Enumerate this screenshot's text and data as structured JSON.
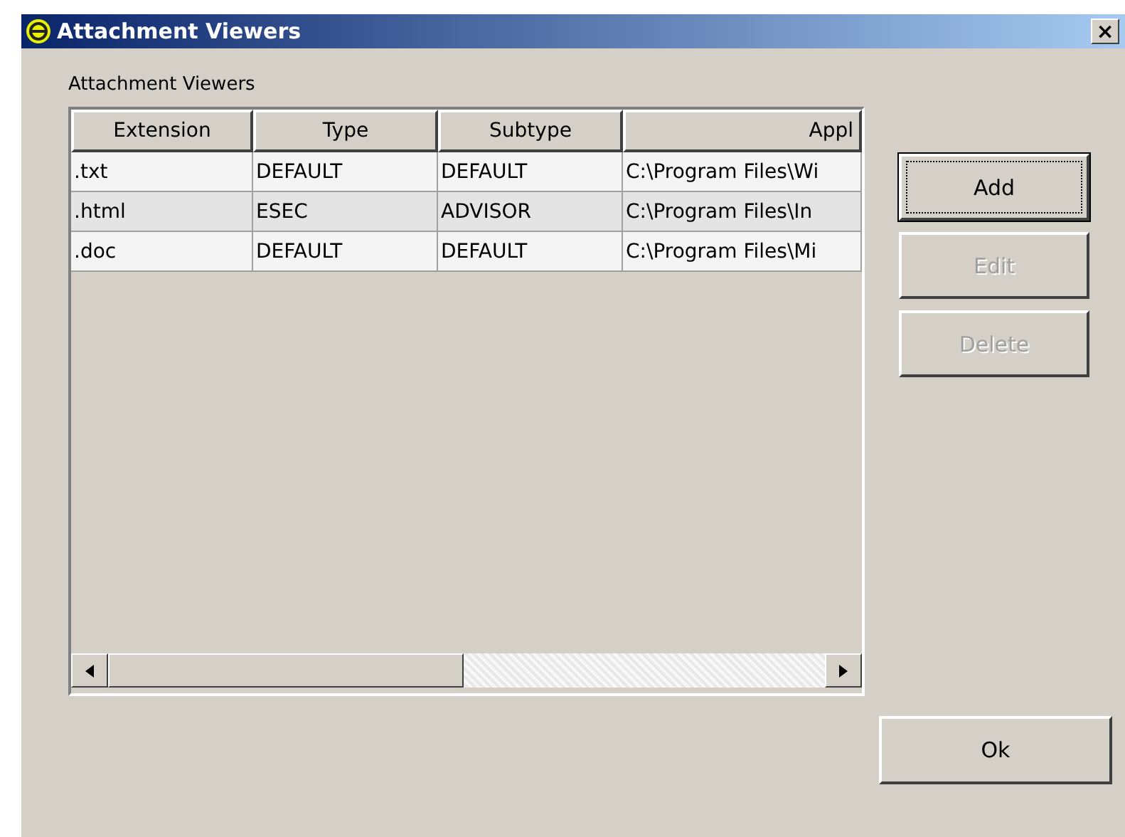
{
  "window": {
    "title": "Attachment Viewers",
    "close": "×"
  },
  "group_label": "Attachment Viewers",
  "table": {
    "columns": [
      "Extension",
      "Type",
      "Subtype",
      "Appl"
    ],
    "rows": [
      {
        "cells": [
          ".txt",
          "DEFAULT",
          "DEFAULT",
          "C:\\Program Files\\Wi"
        ]
      },
      {
        "cells": [
          ".html",
          "ESEC",
          "ADVISOR",
          "C:\\Program Files\\In"
        ]
      },
      {
        "cells": [
          ".doc",
          "DEFAULT",
          "DEFAULT",
          "C:\\Program Files\\Mi"
        ]
      }
    ]
  },
  "buttons": [
    {
      "label": "Add",
      "disabled": false,
      "focused": true
    },
    {
      "label": "Edit",
      "disabled": true,
      "focused": false
    },
    {
      "label": "Delete",
      "disabled": true,
      "focused": false
    }
  ],
  "ok_button": {
    "label": "Ok"
  }
}
